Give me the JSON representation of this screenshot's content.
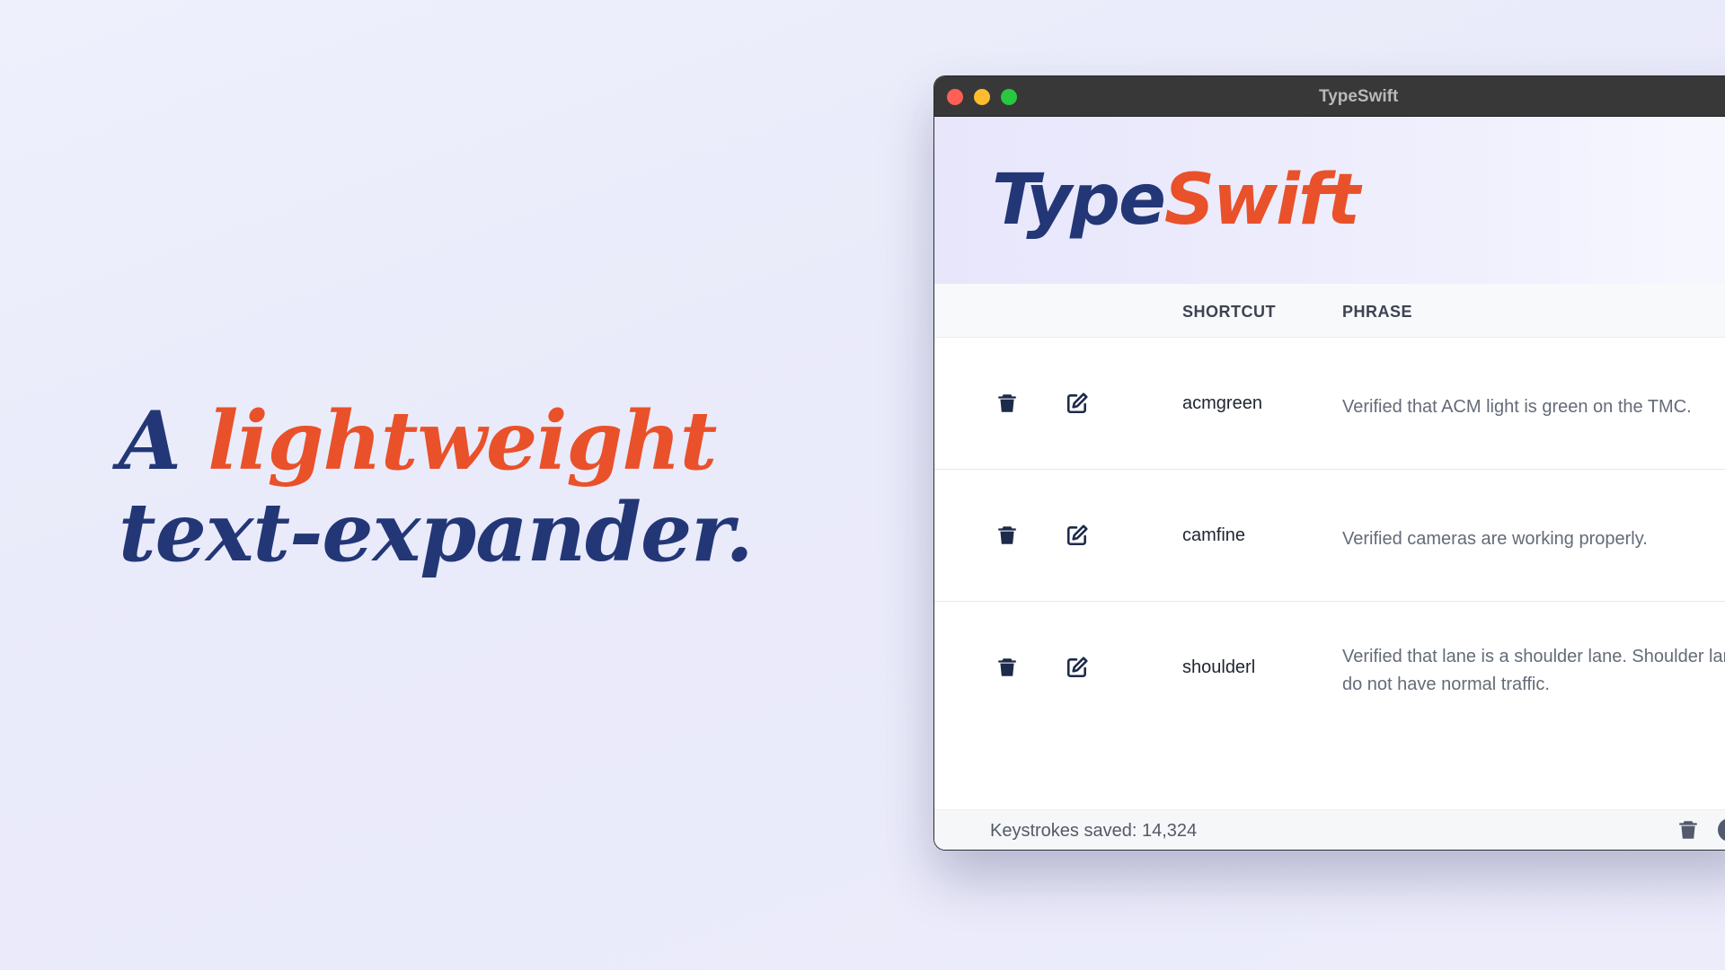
{
  "headline": {
    "word_a": "A",
    "word_accent": "lightweight",
    "line2": "text-expander."
  },
  "window": {
    "title": "TypeSwift",
    "logo_part1": "Type",
    "logo_part2": "Swift"
  },
  "table": {
    "headers": {
      "shortcut": "SHORTCUT",
      "phrase": "PHRASE"
    },
    "rows": [
      {
        "shortcut": "acmgreen",
        "phrase": "Verified that ACM light is green on the TMC."
      },
      {
        "shortcut": "camfine",
        "phrase": "Verified cameras are working properly."
      },
      {
        "shortcut": "shoulderl",
        "phrase": "Verified that lane is a shoulder lane. Shoulder lanes do not have normal traffic."
      }
    ]
  },
  "footer": {
    "stats": "Keystrokes saved: 14,324"
  },
  "icons": {
    "delete": "trash-icon",
    "edit": "edit-icon",
    "settings": "gear-icon"
  },
  "colors": {
    "navy": "#233777",
    "orange": "#e9512a"
  }
}
